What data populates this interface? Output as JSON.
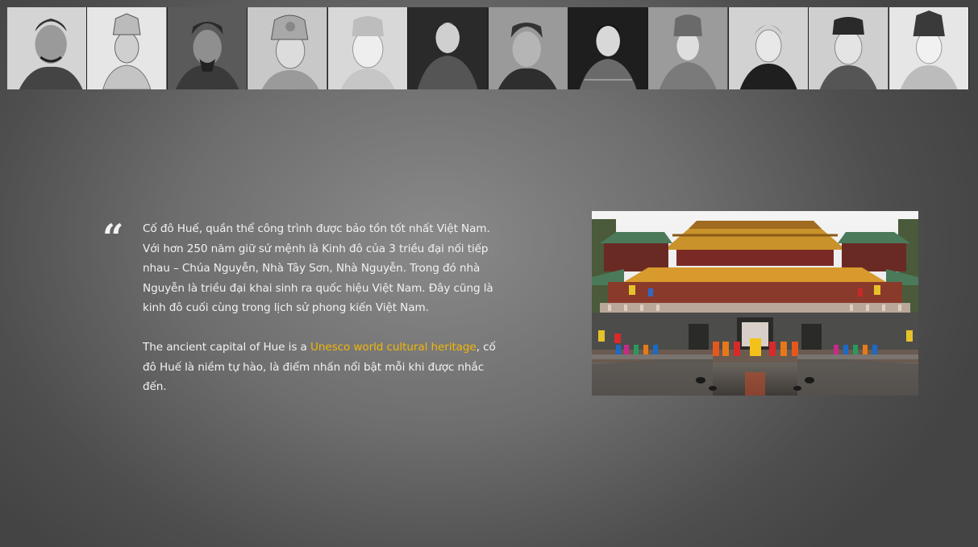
{
  "portrait_strip": {
    "portraits": [
      {
        "icon": "portrait-1-icon",
        "tone": "#d9d9d9"
      },
      {
        "icon": "portrait-2-icon",
        "tone": "#e3e3e3"
      },
      {
        "icon": "portrait-3-icon",
        "tone": "#4a4a4a"
      },
      {
        "icon": "portrait-4-icon",
        "tone": "#bfbfbf"
      },
      {
        "icon": "portrait-5-icon",
        "tone": "#d0d0d0"
      },
      {
        "icon": "portrait-6-icon",
        "tone": "#2e2e2e"
      },
      {
        "icon": "portrait-7-icon",
        "tone": "#7a7a7a"
      },
      {
        "icon": "portrait-8-icon",
        "tone": "#3a3a3a"
      },
      {
        "icon": "portrait-9-icon",
        "tone": "#8c8c8c"
      },
      {
        "icon": "portrait-10-icon",
        "tone": "#cfcfcf"
      },
      {
        "icon": "portrait-11-icon",
        "tone": "#dcdcdc"
      },
      {
        "icon": "portrait-12-icon",
        "tone": "#e8e8e8"
      }
    ]
  },
  "quote": {
    "paragraph_1": "Cố đô Huế, quần thể công trình được bảo tồn tốt nhất Việt Nam. Với hơn 250 năm giữ sứ mệnh là Kinh đô của 3 triều đại nối tiếp nhau – Chúa Nguyễn, Nhà Tây Sơn, Nhà Nguyễn. Trong đó nhà Nguyễn là triều đại khai sinh ra quốc hiệu Việt Nam. Đây cũng là kinh đô cuối cùng trong lịch sử phong kiến Việt Nam.",
    "paragraph_2_before": "The ancient capital of Hue is a ",
    "paragraph_2_link": "Unesco world cultural heritage",
    "paragraph_2_after": ", cố đô Huế là niềm tự hào, là điểm nhấn nổi bật mỗi khi được nhắc đến."
  },
  "colors": {
    "link": "#f2b705",
    "text": "#f2f2f2"
  },
  "photo": {
    "icon": "hue-citadel-ngo-mon-photo"
  }
}
